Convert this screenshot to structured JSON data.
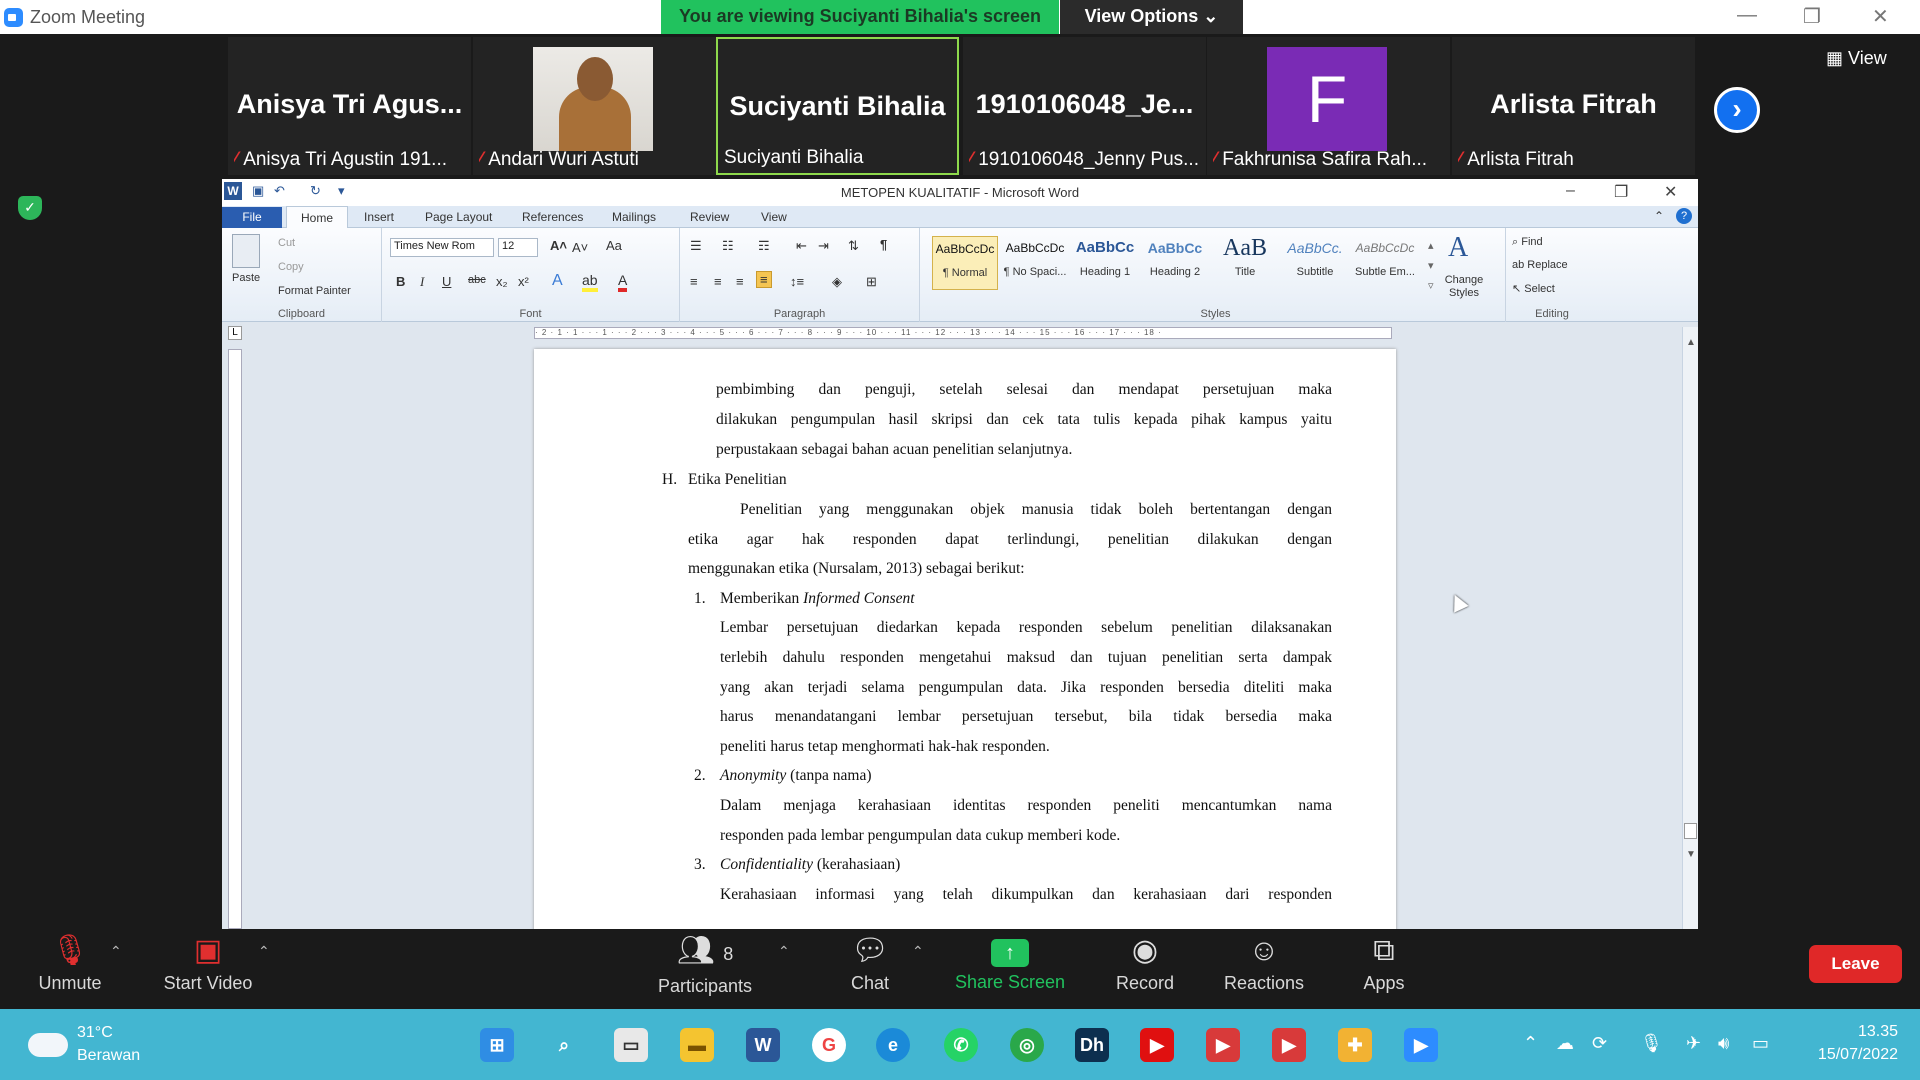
{
  "zoom": {
    "app_title": "Zoom Meeting",
    "banner": "You are viewing Suciyanti Bihalia's screen",
    "view_options": "View Options",
    "view_button": "View",
    "thumbnails": [
      {
        "big": "Anisya Tri Agus...",
        "caption": "Anisya Tri Agustin 191...",
        "muted": true
      },
      {
        "big": "",
        "caption": "Andari Wuri Astuti",
        "muted": true
      },
      {
        "big": "Suciyanti Bihalia",
        "caption": "Suciyanti Bihalia",
        "muted": false
      },
      {
        "big": "1910106048_Je...",
        "caption": "1910106048_Jenny Pus...",
        "muted": true
      },
      {
        "big": "F",
        "caption": "Fakhrunisa Safira Rah...",
        "muted": true
      },
      {
        "big": "Arlista Fitrah",
        "caption": "Arlista Fitrah",
        "muted": true
      }
    ],
    "controls": {
      "unmute": "Unmute",
      "start_video": "Start Video",
      "participants": "Participants",
      "participants_count": "8",
      "chat": "Chat",
      "share_screen": "Share Screen",
      "record": "Record",
      "reactions": "Reactions",
      "apps": "Apps",
      "leave": "Leave"
    },
    "accent": "#21c25e",
    "leave_color": "#e02828"
  },
  "word": {
    "title": "METOPEN KUALITATIF - Microsoft Word",
    "tabs": {
      "file": "File",
      "home": "Home",
      "insert": "Insert",
      "page_layout": "Page Layout",
      "references": "References",
      "mailings": "Mailings",
      "review": "Review",
      "view": "View"
    },
    "clipboard": {
      "paste": "Paste",
      "cut": "Cut",
      "copy": "Copy",
      "format_painter": "Format Painter",
      "label": "Clipboard"
    },
    "font": {
      "name": "Times New Rom",
      "size": "12",
      "label": "Font"
    },
    "paragraph": {
      "label": "Paragraph"
    },
    "styles": {
      "label": "Styles",
      "items": [
        {
          "preview": "AaBbCcDc",
          "name": "¶ Normal"
        },
        {
          "preview": "AaBbCcDc",
          "name": "¶ No Spaci..."
        },
        {
          "preview": "AaBbCc",
          "name": "Heading 1"
        },
        {
          "preview": "AaBbCc",
          "name": "Heading 2"
        },
        {
          "preview": "AaB",
          "name": "Title"
        },
        {
          "preview": "AaBbCc.",
          "name": "Subtitle"
        },
        {
          "preview": "AaBbCcDc",
          "name": "Subtle Em..."
        }
      ],
      "change_styles": "Change Styles"
    },
    "editing": {
      "find": "Find",
      "replace": "Replace",
      "select": "Select",
      "label": "Editing"
    },
    "ruler": "· 2 · 1 · 1 · · · 1 · · · 2 · · · 3 · · · 4 · · · 5 · · · 6 · · · 7 · · · 8 · · · 9 · · · 10 · · · 11 · · · 12 · · · 13 · · · 14 · · · 15 · · · 16 · · · 17 · · · 18 ·",
    "doc": {
      "p1": [
        "pembimbing dan penguji, setelah selesai dan mendapat persetujuan maka",
        "dilakukan pengumpulan hasil skripsi dan cek tata tulis kepada pihak kampus yaitu",
        "perpustakaan sebagai bahan acuan penelitian selanjutnya."
      ],
      "h_num": "H.",
      "h_title": "Etika Penelitian",
      "p2": [
        "Penelitian yang menggunakan objek manusia tidak boleh bertentangan dengan",
        "etika agar hak responden dapat terlindungi, penelitian dilakukan dengan",
        "menggunakan etika (Nursalam, 2013) sebagai berikut:"
      ],
      "i1_num": "1.",
      "i1_a": "Memberikan ",
      "i1_b": "Informed Consent",
      "p3": [
        "Lembar persetujuan diedarkan kepada responden sebelum penelitian dilaksanakan",
        "terlebih dahulu responden mengetahui maksud dan tujuan penelitian serta dampak",
        "yang akan terjadi selama pengumpulan data. Jika responden bersedia diteliti maka",
        "harus menandatangani lembar persetujuan tersebut, bila tidak bersedia maka",
        "peneliti harus tetap menghormati hak-hak responden."
      ],
      "i2_num": "2.",
      "i2_a": "Anonymity",
      "i2_b": " (tanpa nama)",
      "p4": [
        "Dalam menjaga kerahasiaan identitas responden peneliti mencantumkan nama",
        "responden pada lembar pengumpulan data cukup memberi kode."
      ],
      "i3_num": "3.",
      "i3_a": "Confidentiality",
      "i3_b": " (kerahasiaan)",
      "p5": [
        "Kerahasiaan informasi yang telah dikumpulkan dan kerahasiaan dari responden"
      ]
    }
  },
  "taskbar": {
    "temp": "31°C",
    "weather": "Berawan",
    "time": "13.35",
    "date": "15/07/2022"
  }
}
